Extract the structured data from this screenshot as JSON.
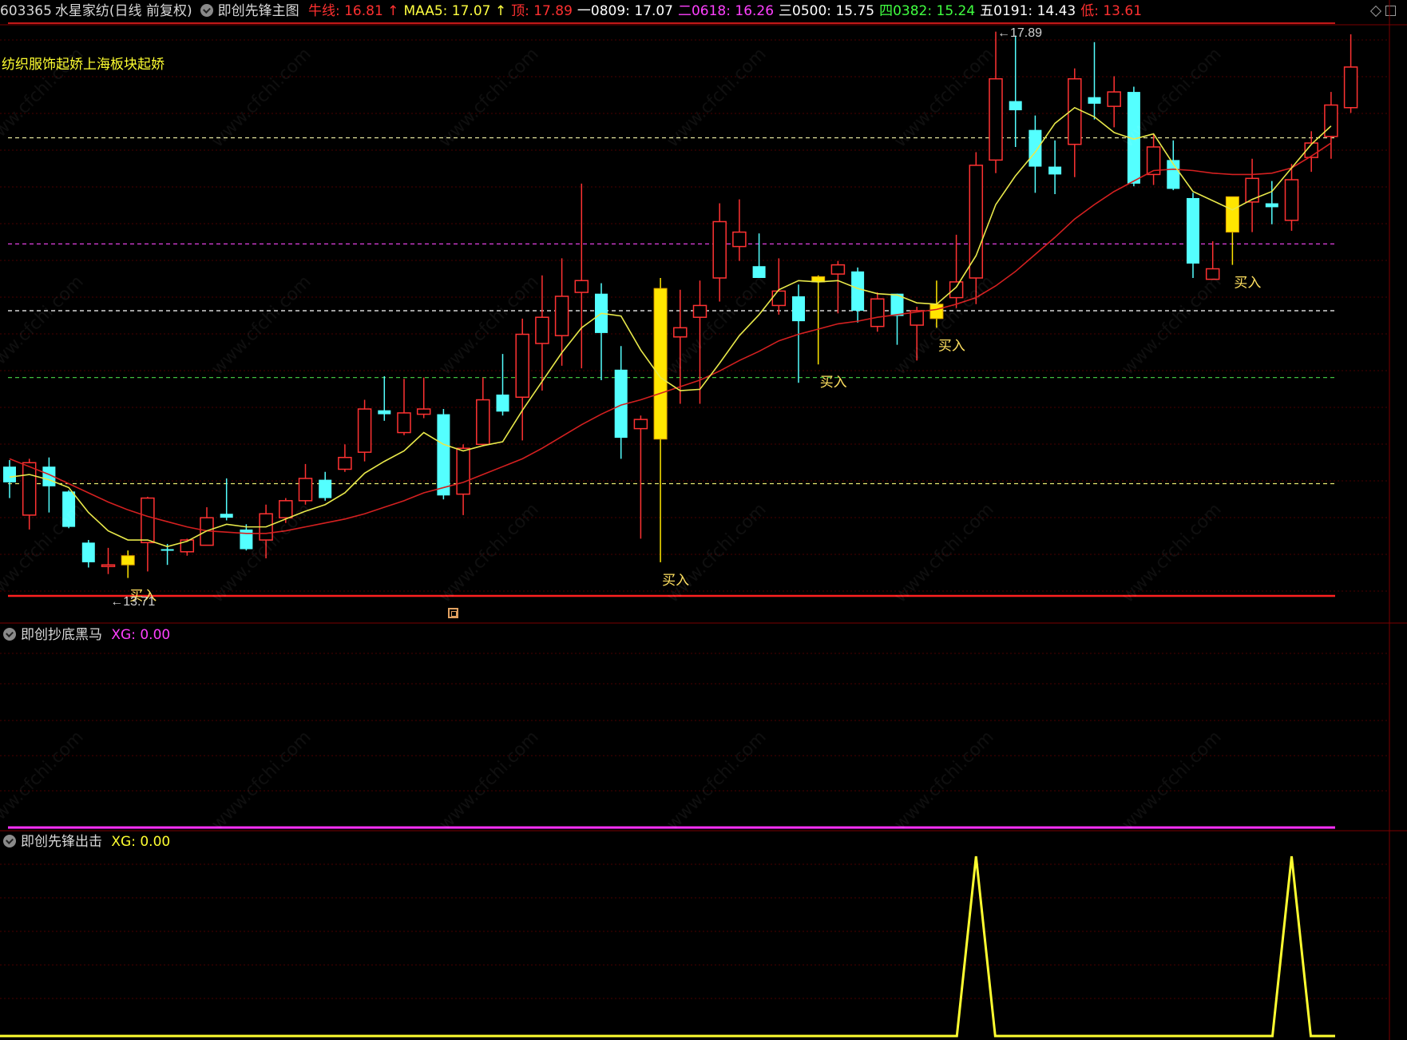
{
  "header": {
    "code": "603365",
    "name": "水星家纺(日线 前复权)",
    "indicator": "即创先锋主图",
    "items": [
      {
        "label": "牛线:",
        "value": "16.81",
        "color": "#ff3030",
        "arrow": "↑"
      },
      {
        "label": "MAA5:",
        "value": "17.07",
        "color": "#ffff40",
        "arrow": "↑"
      },
      {
        "label": "顶:",
        "value": "17.89",
        "color": "#ff3030",
        "arrow": ""
      },
      {
        "label": "一0809:",
        "value": "17.07",
        "color": "#ffffff",
        "arrow": ""
      },
      {
        "label": "二0618:",
        "value": "16.26",
        "color": "#ff40ff",
        "arrow": ""
      },
      {
        "label": "三0500:",
        "value": "15.75",
        "color": "#ffffff",
        "arrow": ""
      },
      {
        "label": "四0382:",
        "value": "15.24",
        "color": "#40ff40",
        "arrow": ""
      },
      {
        "label": "五0191:",
        "value": "14.43",
        "color": "#ffffff",
        "arrow": ""
      },
      {
        "label": "低:",
        "value": "13.61",
        "color": "#ff3030",
        "arrow": ""
      }
    ]
  },
  "main_note": "纺织服饰起娇上海板块起娇",
  "high_label": "17.89",
  "low_label": "13.71",
  "buy_label": "买入",
  "panel1": {
    "title": "即创抄底黑马",
    "xg": "XG: 0.00"
  },
  "panel2": {
    "title": "即创先锋出击",
    "xg": "XG: 0.00"
  },
  "watermark": "www.cfchi.com",
  "colors": {
    "up": "#ff3232",
    "down": "#54ffff",
    "buy": "#ffe600",
    "ma5": "#e8e84a",
    "ma_slow": "#d42020"
  },
  "chart_data": {
    "type": "candlestick",
    "price_range": [
      13.61,
      17.89
    ],
    "levels": [
      {
        "name": "一0809",
        "value": 17.07
      },
      {
        "name": "二0618",
        "value": 16.26
      },
      {
        "name": "三0500",
        "value": 15.75
      },
      {
        "name": "四0382",
        "value": 15.24
      },
      {
        "name": "五0191",
        "value": 14.43
      }
    ],
    "candles": [
      [
        14.44,
        14.56,
        14.61,
        14.32,
        "d"
      ],
      [
        14.19,
        14.59,
        14.62,
        14.08,
        "u"
      ],
      [
        14.56,
        14.41,
        14.63,
        14.21,
        "d"
      ],
      [
        14.37,
        14.1,
        14.38,
        14.09,
        "d"
      ],
      [
        13.98,
        13.83,
        14.0,
        13.79,
        "d"
      ],
      [
        13.81,
        13.8,
        13.94,
        13.74,
        "u"
      ],
      [
        13.81,
        13.88,
        13.92,
        13.71,
        "b"
      ],
      [
        13.98,
        14.32,
        14.33,
        13.76,
        "u"
      ],
      [
        13.93,
        13.92,
        13.97,
        13.81,
        "d"
      ],
      [
        13.91,
        14.0,
        14.01,
        13.88,
        "u"
      ],
      [
        13.96,
        14.17,
        14.25,
        13.96,
        "u"
      ],
      [
        14.17,
        14.2,
        14.47,
        14.15,
        "d"
      ],
      [
        14.08,
        13.93,
        14.12,
        13.92,
        "d"
      ],
      [
        14.0,
        14.2,
        14.27,
        13.86,
        "u"
      ],
      [
        14.17,
        14.3,
        14.32,
        14.13,
        "u"
      ],
      [
        14.3,
        14.47,
        14.58,
        14.27,
        "u"
      ],
      [
        14.46,
        14.32,
        14.52,
        14.3,
        "d"
      ],
      [
        14.54,
        14.63,
        14.73,
        14.52,
        "u"
      ],
      [
        14.67,
        15.0,
        15.07,
        14.6,
        "u"
      ],
      [
        14.99,
        14.96,
        15.25,
        14.91,
        "d"
      ],
      [
        14.82,
        14.97,
        15.23,
        14.8,
        "u"
      ],
      [
        15.0,
        14.96,
        15.24,
        14.93,
        "u"
      ],
      [
        14.96,
        14.34,
        15.0,
        14.31,
        "d"
      ],
      [
        14.35,
        14.7,
        14.73,
        14.19,
        "u"
      ],
      [
        14.73,
        15.07,
        15.24,
        14.79,
        "u"
      ],
      [
        15.11,
        14.98,
        15.42,
        14.95,
        "d"
      ],
      [
        15.09,
        15.57,
        15.69,
        14.76,
        "u"
      ],
      [
        15.5,
        15.7,
        16.02,
        15.14,
        "u"
      ],
      [
        15.56,
        15.86,
        16.15,
        15.33,
        "u"
      ],
      [
        15.89,
        15.98,
        16.72,
        15.31,
        "u"
      ],
      [
        15.88,
        15.58,
        15.96,
        15.22,
        "d"
      ],
      [
        15.3,
        14.78,
        15.48,
        14.62,
        "d"
      ],
      [
        14.92,
        14.85,
        14.95,
        14.01,
        "u"
      ],
      [
        15.92,
        14.77,
        16.0,
        13.83,
        "b"
      ],
      [
        15.55,
        15.62,
        15.91,
        15.04,
        "u"
      ],
      [
        15.79,
        15.7,
        15.98,
        15.04,
        "u"
      ],
      [
        16.0,
        16.43,
        16.57,
        15.82,
        "u"
      ],
      [
        16.24,
        16.35,
        16.6,
        16.13,
        "u"
      ],
      [
        16.0,
        16.09,
        16.34,
        16.02,
        "d"
      ],
      [
        15.9,
        15.79,
        16.15,
        15.72,
        "u"
      ],
      [
        15.86,
        15.67,
        15.95,
        15.2,
        "d"
      ],
      [
        15.97,
        16.01,
        16.02,
        15.34,
        "b"
      ],
      [
        16.03,
        16.1,
        16.13,
        15.73,
        "u"
      ],
      [
        16.05,
        15.75,
        16.08,
        15.66,
        "d"
      ],
      [
        15.84,
        15.63,
        15.89,
        15.59,
        "u"
      ],
      [
        15.71,
        15.88,
        15.87,
        15.49,
        "d"
      ],
      [
        15.75,
        15.64,
        15.78,
        15.37,
        "u"
      ],
      [
        15.69,
        15.8,
        15.98,
        15.62,
        "b"
      ],
      [
        15.85,
        15.97,
        16.33,
        15.77,
        "u"
      ],
      [
        16.0,
        16.86,
        16.96,
        15.8,
        "u"
      ],
      [
        16.9,
        17.52,
        17.88,
        16.8,
        "u"
      ],
      [
        17.35,
        17.28,
        17.85,
        17.0,
        "d"
      ],
      [
        17.13,
        16.85,
        17.24,
        16.65,
        "d"
      ],
      [
        16.85,
        16.79,
        17.05,
        16.64,
        "d"
      ],
      [
        17.02,
        17.52,
        17.6,
        16.77,
        "u"
      ],
      [
        17.33,
        17.38,
        17.8,
        17.21,
        "d"
      ],
      [
        17.31,
        17.42,
        17.54,
        17.15,
        "u"
      ],
      [
        17.42,
        16.72,
        17.46,
        16.7,
        "d"
      ],
      [
        16.79,
        17.0,
        17.1,
        16.71,
        "u"
      ],
      [
        16.9,
        16.68,
        17.05,
        16.67,
        "d"
      ],
      [
        16.61,
        16.11,
        16.65,
        16.0,
        "d"
      ],
      [
        15.99,
        16.07,
        16.28,
        15.99,
        "u"
      ],
      [
        16.35,
        16.62,
        16.37,
        16.1,
        "b"
      ],
      [
        16.58,
        16.76,
        16.91,
        16.35,
        "u"
      ],
      [
        16.54,
        16.57,
        16.74,
        16.41,
        "d"
      ],
      [
        16.44,
        16.75,
        16.87,
        16.36,
        "u"
      ],
      [
        16.92,
        17.03,
        17.12,
        16.81,
        "u"
      ],
      [
        17.08,
        17.32,
        17.42,
        16.91,
        "u"
      ],
      [
        17.3,
        17.61,
        17.86,
        17.26,
        "u"
      ]
    ],
    "ma5": [
      14.48,
      14.5,
      14.46,
      14.4,
      14.21,
      14.07,
      14.0,
      14.0,
      13.95,
      13.99,
      14.07,
      14.12,
      14.1,
      14.1,
      14.16,
      14.22,
      14.27,
      14.36,
      14.51,
      14.6,
      14.68,
      14.82,
      14.73,
      14.68,
      14.72,
      14.75,
      14.99,
      15.21,
      15.43,
      15.62,
      15.73,
      15.71,
      15.45,
      15.24,
      15.14,
      15.15,
      15.35,
      15.56,
      15.72,
      15.91,
      15.98,
      15.97,
      15.98,
      15.92,
      15.88,
      15.87,
      15.81,
      15.8,
      15.93,
      16.17,
      16.56,
      16.78,
      16.96,
      17.18,
      17.3,
      17.23,
      17.11,
      17.06,
      17.1,
      16.87,
      16.66,
      16.59,
      16.52,
      16.6,
      16.66,
      16.84,
      17.02,
      17.16
    ],
    "ma_slow": [
      14.62,
      14.56,
      14.5,
      14.43,
      14.36,
      14.29,
      14.23,
      14.18,
      14.14,
      14.1,
      14.07,
      14.06,
      14.05,
      14.05,
      14.07,
      14.1,
      14.13,
      14.16,
      14.2,
      14.25,
      14.3,
      14.36,
      14.4,
      14.44,
      14.5,
      14.56,
      14.62,
      14.7,
      14.79,
      14.88,
      14.96,
      15.03,
      15.07,
      15.12,
      15.17,
      15.22,
      15.29,
      15.37,
      15.44,
      15.52,
      15.57,
      15.61,
      15.65,
      15.67,
      15.7,
      15.72,
      15.74,
      15.76,
      15.8,
      15.85,
      15.94,
      16.05,
      16.18,
      16.31,
      16.45,
      16.56,
      16.66,
      16.74,
      16.82,
      16.83,
      16.82,
      16.8,
      16.79,
      16.79,
      16.8,
      16.84,
      16.93,
      17.03
    ],
    "signal_xg": {
      "panel": "即创先锋出击",
      "peaks_at_index": [
        49,
        65
      ],
      "values": "0 or 1"
    }
  }
}
